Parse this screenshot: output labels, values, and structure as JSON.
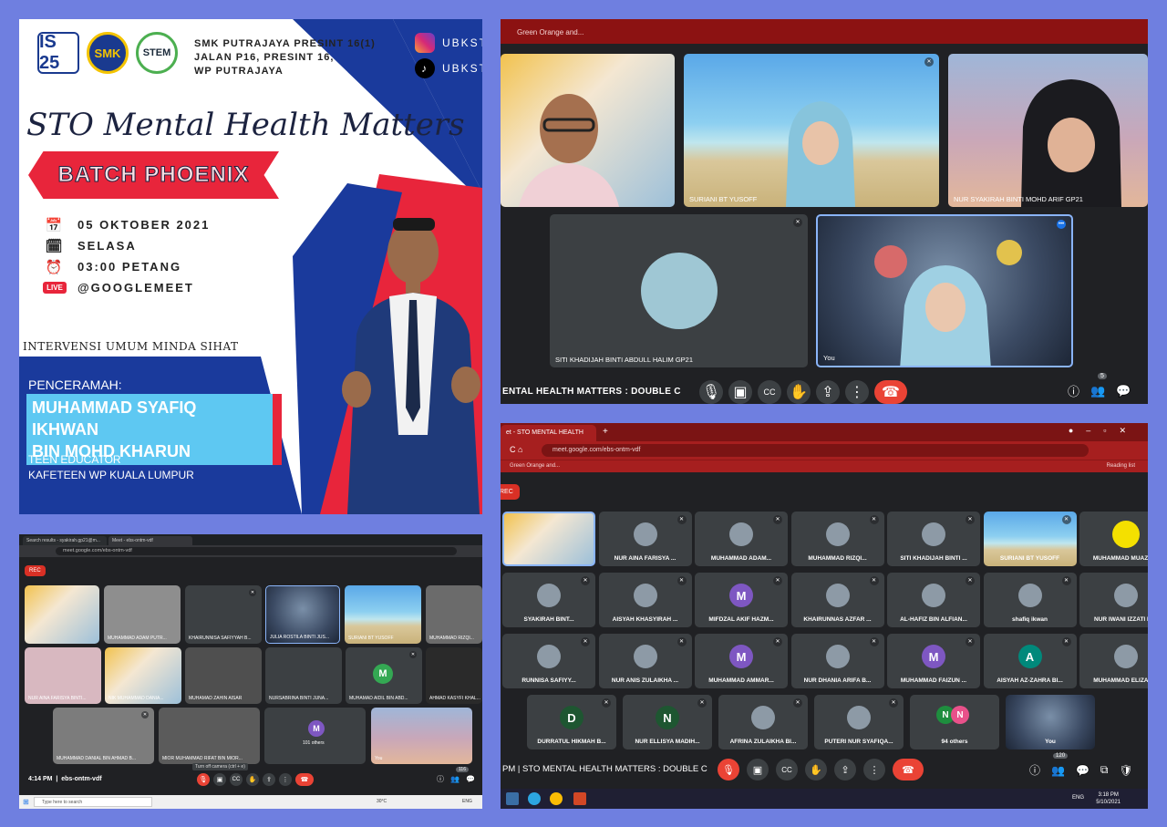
{
  "poster": {
    "school_lines": "SMK PUTRAJAYA PRESINT 16(1)\nJALAN P16, PRESINT 16,\nWP PUTRAJAYA",
    "logo1": "IS 25",
    "logo2": "SMK",
    "logo3": "STEM",
    "social": [
      "UBKSTO",
      "UBKSTO"
    ],
    "title": "STO Mental Health Matters",
    "batch": "BATCH PHOENIX",
    "date": "05 OKTOBER 2021",
    "day": "SELASA",
    "time": "03:00 PETANG",
    "live_label": "LIVE",
    "platform": "@GOOGLEMEET",
    "intervensi": "INTERVENSI UMUM MINDA SIHAT",
    "speaker_label": "PENCERAMAH:",
    "speaker_line1": "MUHAMMAD SYAFIQ IKHWAN",
    "speaker_line2": "BIN MOHD KHARUN",
    "role_line1": "TEEN EDUCATOR",
    "role_line2": "KAFETEEN WP KUALA LUMPUR"
  },
  "meet1": {
    "tab_text": "Green Orange and...",
    "tiles": [
      {
        "name": ""
      },
      {
        "name": "SURIANI BT YUSOFF"
      },
      {
        "name": "NUR SYAKIRAH BINTI MOHD ARIF GP21"
      },
      {
        "name": "SITI KHADIJAH BINTI ABDULL HALIM GP21"
      },
      {
        "name": "You"
      }
    ],
    "meeting_name": "ENTAL HEALTH MATTERS : DOUBLE C",
    "participants": "5"
  },
  "meet2": {
    "tab1": "Search results - syakirah.gp21@m...",
    "tab2": "Meet - ebs-ontm-vdf",
    "url": "meet.google.com/ebs-ontm-vdf",
    "rec": "REC",
    "tiles": [
      {
        "name": ""
      },
      {
        "name": "MUHAMMAD ADAM PUTR..."
      },
      {
        "name": "KHAIRUNNISA SAFIYYAH B..."
      },
      {
        "name": "JULIA ROSTILA BINTI JUS..."
      },
      {
        "name": "SURIANI BT YUSOFF"
      },
      {
        "name": "MUHAMMAD RIZQI..."
      },
      {
        "name": "NUR AINA FARISYA BINTI..."
      },
      {
        "name": "NIK MUHAMMAD DANIA..."
      },
      {
        "name": "MUHAMAD ZAHIN AISAR"
      },
      {
        "name": "NURSABRINA BINTI JUNA..."
      },
      {
        "name": "MUHAMAD AIDIL BIN ABD..."
      },
      {
        "name": "AHMAD KASYFI KHAL..."
      },
      {
        "name": "MUHAMMAD DANIAL BIN AHMAD B..."
      },
      {
        "name": "MIOR MUHAMMAD RIFAT BIN MIOR..."
      },
      {
        "name": "101 others"
      },
      {
        "name": "You"
      }
    ],
    "avatar_m": "M",
    "time": "4:14 PM",
    "code": "ebs-ontm-vdf",
    "tooltip": "Turn off camera (ctrl + e)",
    "search": "Type here to search",
    "weather": "30°C",
    "lang": "ENG",
    "participants": "116"
  },
  "meet3": {
    "tab": "et - STO MENTAL HEALTH",
    "url": "meet.google.com/ebs-ontm-vdf",
    "bookmark": "Green Orange and...",
    "reading_list": "Reading list",
    "rec": "REC",
    "tiles": [
      {
        "name": "",
        "letter": ""
      },
      {
        "name": "NUR AINA FARISYA ...",
        "letter": ""
      },
      {
        "name": "MUHAMMAD ADAM...",
        "letter": ""
      },
      {
        "name": "MUHAMMAD RIZQI...",
        "letter": ""
      },
      {
        "name": "SITI KHADIJAH BINTI ...",
        "letter": ""
      },
      {
        "name": "SURIANI BT YUSOFF",
        "letter": ""
      },
      {
        "name": "MUHAMMAD MUAZ B...",
        "letter": ""
      },
      {
        "name": "SYAKIRAH BINT...",
        "letter": ""
      },
      {
        "name": "AISYAH KHASYIRAH ...",
        "letter": ""
      },
      {
        "name": "MIFDZAL AKIF HAZM...",
        "letter": "M"
      },
      {
        "name": "KHAIRUNNAS AZFAR ...",
        "letter": ""
      },
      {
        "name": "AL-HAFIZ BIN ALFIAN...",
        "letter": ""
      },
      {
        "name": "shafiq ikwan",
        "letter": ""
      },
      {
        "name": "NUR IWANI IZZATI BI...",
        "letter": ""
      },
      {
        "name": "RUNNISA SAFIYY...",
        "letter": ""
      },
      {
        "name": "NUR ANIS ZULAIKHA ...",
        "letter": ""
      },
      {
        "name": "MUHAMMAD AMMAR...",
        "letter": "M"
      },
      {
        "name": "NUR DHANIA ARIFA B...",
        "letter": ""
      },
      {
        "name": "MUHAMMAD FAIZUN ...",
        "letter": "M"
      },
      {
        "name": "AISYAH AZ-ZAHRA BI...",
        "letter": "A"
      },
      {
        "name": "MUHAMMAD ELIZA E...",
        "letter": ""
      },
      {
        "name": "DURRATUL HIKMAH B...",
        "letter": "D"
      },
      {
        "name": "NUR ELLISYA MADIH...",
        "letter": "N"
      },
      {
        "name": "AFRINA ZULAIKHA BI...",
        "letter": ""
      },
      {
        "name": "PUTERI NUR SYAFIQA...",
        "letter": ""
      },
      {
        "name": "94 others",
        "letter": ""
      },
      {
        "name": "You",
        "letter": ""
      }
    ],
    "others_letters": [
      "N",
      "N"
    ],
    "meeting_name": "PM  |  STO MENTAL HEALTH MATTERS : DOUBLE C",
    "participants": "120",
    "lang": "ENG",
    "clock_time": "3:18 PM",
    "clock_date": "5/10/2021"
  }
}
